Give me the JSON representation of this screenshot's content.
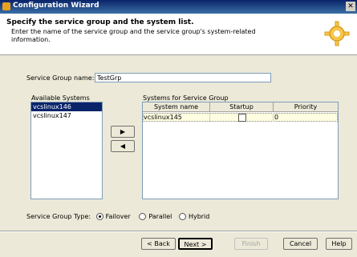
{
  "window": {
    "title": "Configuration Wizard",
    "close_glyph": "✕"
  },
  "header": {
    "title": "Specify the service group and the system list.",
    "description": "Enter the name of the service group and the service group's system-related information."
  },
  "service_group": {
    "label": "Service Group name:",
    "value": "TestGrp"
  },
  "available_systems": {
    "label": "Available Systems",
    "items": [
      "vcslinux146",
      "vcslinux147"
    ]
  },
  "systems_for_group": {
    "label": "Systems for Service Group",
    "columns": [
      "System name",
      "Startup",
      "Priority"
    ],
    "rows": [
      {
        "name": "vcslinux145",
        "startup": false,
        "priority": "0"
      }
    ]
  },
  "move_buttons": {
    "add": "▶",
    "remove": "◀"
  },
  "group_type": {
    "label": "Service Group Type:",
    "options": [
      "Failover",
      "Parallel",
      "Hybrid"
    ],
    "selected": "Failover"
  },
  "footer": {
    "back": "< Back",
    "next": "Next >",
    "finish": "Finish",
    "cancel": "Cancel",
    "help": "Help"
  },
  "colors": {
    "titlebar": "#0a246a",
    "selection": "#0a246a",
    "dialog_bg": "#ece9d8"
  }
}
